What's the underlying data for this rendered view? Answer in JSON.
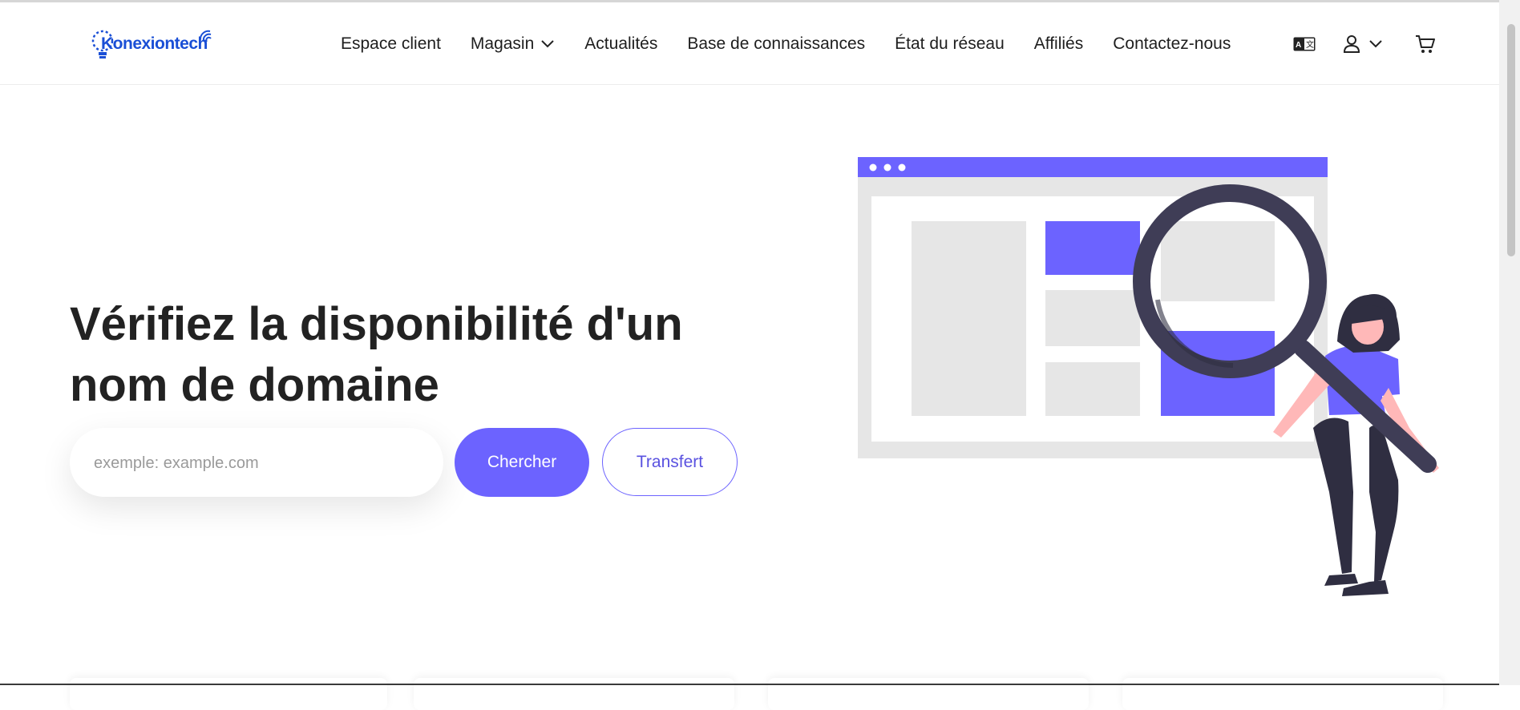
{
  "brand": {
    "name": "Konexiontech",
    "color": "#1a4fd6"
  },
  "nav": {
    "items": [
      {
        "label": "Espace client"
      },
      {
        "label": "Magasin",
        "has_dropdown": true
      },
      {
        "label": "Actualités"
      },
      {
        "label": "Base de connaissances"
      },
      {
        "label": "État du réseau"
      },
      {
        "label": "Affiliés"
      },
      {
        "label": "Contactez-nous"
      }
    ]
  },
  "header_icons": [
    "translate-icon",
    "user-icon",
    "chevron-down-icon",
    "cart-icon"
  ],
  "hero": {
    "title": "Vérifiez la disponibilité d'un nom de domaine",
    "search_placeholder": "exemple: example.com",
    "search_value": "",
    "search_button": "Chercher",
    "transfer_button": "Transfert"
  },
  "colors": {
    "accent": "#6c63ff",
    "text": "#222222",
    "illustration_dark": "#3f3d56",
    "illustration_gray": "#e6e6e6"
  }
}
